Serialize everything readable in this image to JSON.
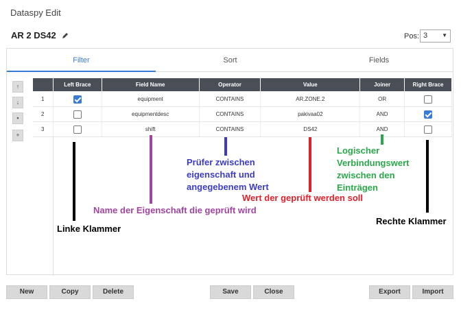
{
  "app": {
    "title": "Dataspy Edit",
    "subtitle": "AR 2 DS42"
  },
  "position": {
    "label": "Pos:",
    "value": "3"
  },
  "tabs": [
    "Filter",
    "Sort",
    "Fields"
  ],
  "side_buttons": [
    "↑",
    "↓",
    "🗑",
    "+"
  ],
  "table": {
    "headers": [
      "Left Brace",
      "Field Name",
      "Operator",
      "Value",
      "Joiner",
      "Right Brace"
    ],
    "rows": [
      {
        "num": "1",
        "left_brace": true,
        "field": "equipment",
        "operator": "CONTAINS",
        "value": "AR.ZONE.2",
        "joiner": "OR",
        "right_brace": false
      },
      {
        "num": "2",
        "left_brace": false,
        "field": "equipmentdesc",
        "operator": "CONTAINS",
        "value": "pakivaa02",
        "joiner": "AND",
        "right_brace": true
      },
      {
        "num": "3",
        "left_brace": false,
        "field": "shift",
        "operator": "CONTAINS",
        "value": "DS42",
        "joiner": "AND",
        "right_brace": false
      }
    ]
  },
  "annotations": {
    "left_brace": "Linke Klammer",
    "field_name": "Name der Eigenschaft die geprüft wird",
    "operator": "Prüfer zwischen eigenschaft und angegebenem Wert",
    "value": "Wert der geprüft werden soll",
    "joiner": "Logischer Verbindungswert zwischen den Einträgen",
    "right_brace": "Rechte Klammer"
  },
  "colors": {
    "accent": "#3a7bd5",
    "header": "#4a4f57",
    "black": "#000000",
    "purple": "#a044a0",
    "blue": "#3b3bc8",
    "red": "#e0202a",
    "green": "#2aa84a"
  },
  "buttons": {
    "new": "New",
    "copy": "Copy",
    "delete": "Delete",
    "save": "Save",
    "close": "Close",
    "export": "Export",
    "import": "Import"
  }
}
